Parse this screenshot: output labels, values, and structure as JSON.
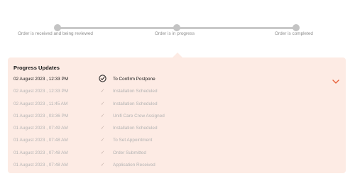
{
  "steps": [
    {
      "label": "Order is received and being reviewed"
    },
    {
      "label": "Order is in progress"
    },
    {
      "label": "Order is completed"
    }
  ],
  "panel": {
    "title": "Progress Updates",
    "toggle_icon": "chevron-down-icon",
    "accent_color": "#e8623a",
    "background_color": "#fdebe4"
  },
  "updates": [
    {
      "date": "02 August 2023 , 12:33 PM",
      "status": "To Confirm Postpone",
      "icon": "circle-check-icon",
      "current": true
    },
    {
      "date": "02 August 2023 , 12:33 PM",
      "status": "Installation Scheduled",
      "icon": "check-icon",
      "current": false
    },
    {
      "date": "02 August 2023 , 11:45 AM",
      "status": "Installation Scheduled",
      "icon": "check-icon",
      "current": false
    },
    {
      "date": "01 August 2023 , 03:36 PM",
      "status": "Unifi Care Crew Assigned",
      "icon": "check-icon",
      "current": false
    },
    {
      "date": "01 August 2023 , 07:49 AM",
      "status": "Installation Scheduled",
      "icon": "check-icon",
      "current": false
    },
    {
      "date": "01 August 2023 , 07:48 AM",
      "status": "To Set Appointment",
      "icon": "check-icon",
      "current": false
    },
    {
      "date": "01 August 2023 , 07:48 AM",
      "status": "Order Submitted",
      "icon": "check-icon",
      "current": false
    },
    {
      "date": "01 August 2023 , 07:48 AM",
      "status": "Application Received",
      "icon": "check-icon",
      "current": false
    }
  ]
}
